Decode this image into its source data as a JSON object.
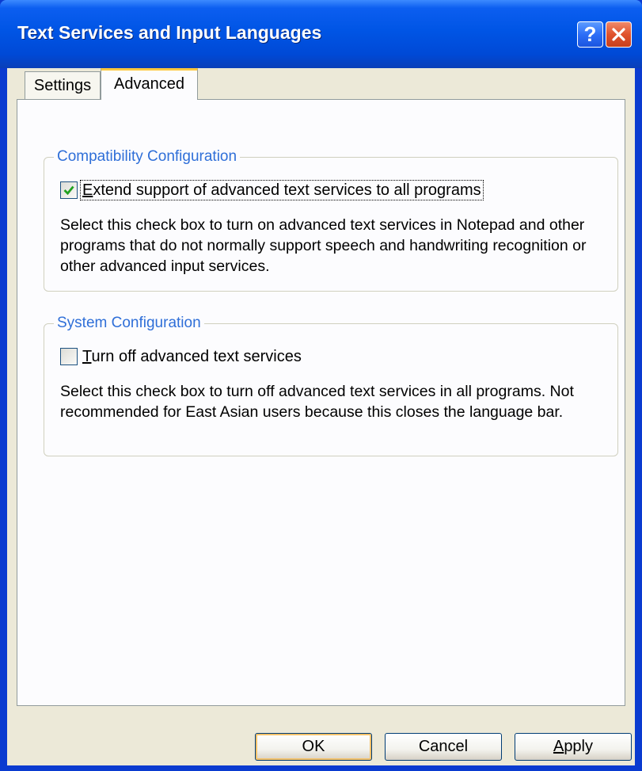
{
  "window": {
    "title": "Text Services and Input Languages",
    "help_glyph": "?",
    "accent_colors": {
      "titlebar": "#0055e5",
      "legend_text": "#2f6fd8",
      "active_tab_highlight": "#ffc83c",
      "close_button": "#e0522c"
    }
  },
  "tabs": [
    {
      "label": "Settings",
      "selected": false
    },
    {
      "label": "Advanced",
      "selected": true
    }
  ],
  "compatibility": {
    "legend": "Compatibility Configuration",
    "checkbox_mnemonic": "E",
    "checkbox_rest": "xtend support of advanced text services to all programs",
    "checked": true,
    "description": "Select this check box to turn on advanced text services in Notepad and other programs that do not normally support speech and handwriting recognition or other advanced input services."
  },
  "system": {
    "legend": "System Configuration",
    "checkbox_mnemonic": "T",
    "checkbox_rest": "urn off advanced text services",
    "checked": false,
    "description": "Select this check box to turn off advanced text services in all programs. Not recommended for East Asian users because this closes the language bar."
  },
  "buttons": {
    "ok": "OK",
    "cancel": "Cancel",
    "apply_mnemonic": "A",
    "apply_rest": "pply"
  },
  "icons": {
    "help": "question-mark-icon",
    "close": "close-x-icon",
    "check": "checkmark-icon"
  }
}
